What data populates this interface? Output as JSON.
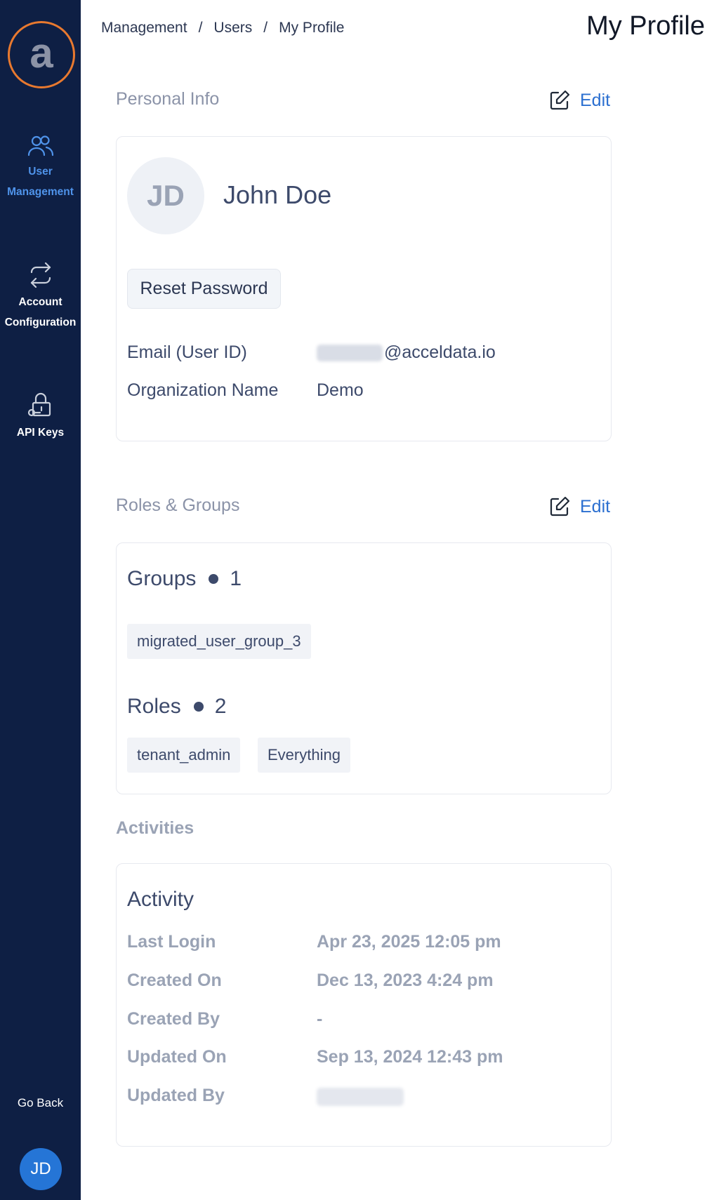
{
  "sidebar": {
    "logo_letter": "a",
    "items": [
      {
        "label_line1": "User",
        "label_line2": "Management",
        "icon": "users-icon",
        "active": true
      },
      {
        "label_line1": "Account",
        "label_line2": "Configuration",
        "icon": "swap-arrows-icon",
        "active": false
      },
      {
        "label_line1": "API Keys",
        "icon": "lock-key-icon",
        "active": false
      }
    ],
    "go_back": "Go Back",
    "user_initials": "JD"
  },
  "header": {
    "breadcrumb": [
      "Management",
      "Users",
      "My Profile"
    ],
    "separator": "/",
    "title": "My Profile"
  },
  "personal_info": {
    "section_title": "Personal Info",
    "edit_label": "Edit",
    "avatar_initials": "JD",
    "name": "John Doe",
    "reset_password_label": "Reset Password",
    "email_label": "Email (User ID)",
    "email_domain": "@acceldata.io",
    "org_label": "Organization Name",
    "org_value": "Demo"
  },
  "roles_groups": {
    "section_title": "Roles & Groups",
    "edit_label": "Edit",
    "groups_label": "Groups",
    "groups_count": "1",
    "groups": [
      "migrated_user_group_3"
    ],
    "roles_label": "Roles",
    "roles_count": "2",
    "roles": [
      "tenant_admin",
      "Everything"
    ]
  },
  "activities": {
    "section_title": "Activities",
    "heading": "Activity",
    "rows": [
      {
        "label": "Last Login",
        "value": "Apr 23, 2025 12:05 pm"
      },
      {
        "label": "Created On",
        "value": "Dec 13, 2023 4:24 pm"
      },
      {
        "label": "Created By",
        "value": "-"
      },
      {
        "label": "Updated On",
        "value": "Sep 13, 2024 12:43 pm"
      },
      {
        "label": "Updated By",
        "value": ""
      }
    ]
  },
  "colors": {
    "sidebar_bg": "#0e1f44",
    "accent": "#2b6fd0",
    "logo_ring": "#e8792f",
    "active_nav": "#4f93ea"
  }
}
